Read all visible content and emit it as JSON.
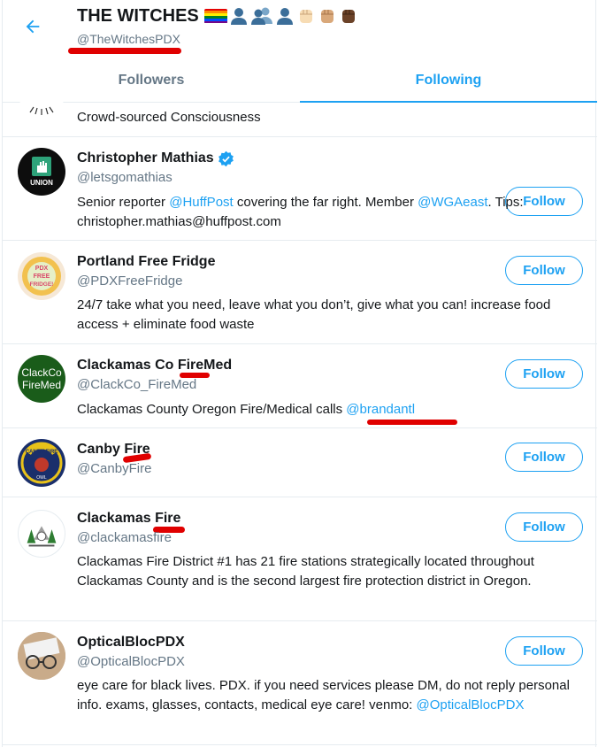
{
  "header": {
    "title": "THE WITCHES",
    "handle": "@TheWitchesPDX"
  },
  "tabs": [
    {
      "label": "Followers",
      "active": false
    },
    {
      "label": "Following",
      "active": true
    }
  ],
  "follow_label": "Follow",
  "accounts": [
    {
      "bio": "Crowd-sourced Consciousness"
    },
    {
      "name": "Christopher Mathias",
      "username": "@letsgomathias",
      "verified": true,
      "avatar_text": "UNION",
      "bio_parts": [
        "Senior reporter ",
        "@HuffPost",
        " covering the far right. Member ",
        "@WGAeast",
        ". Tips: christopher.mathias@huffpost.com"
      ]
    },
    {
      "name": "Portland Free Fridge",
      "username": "@PDXFreeFridge",
      "avatar_text": "PDX FREE FRIDGE!",
      "bio": "24/7 take what you need, leave what you don’t, give what you can! increase food access + eliminate food waste"
    },
    {
      "name": "Clackamas Co FireMed",
      "username": "@ClackCo_FireMed",
      "avatar_text_1": "ClackCo",
      "avatar_text_2": "FireMed",
      "bio_parts": [
        "Clackamas County Oregon Fire/Medical calls ",
        "@brandantl"
      ]
    },
    {
      "name": "Canby Fire",
      "username": "@CanbyFire",
      "avatar_text": "CANBY FIRE"
    },
    {
      "name": "Clackamas Fire",
      "username": "@clackamasfire",
      "bio": "Clackamas Fire District #1 has 21 fire stations strategically located throughout Clackamas County and is the second largest fire protection district in Oregon."
    },
    {
      "name": "OpticalBlocPDX",
      "username": "@OpticalBlocPDX",
      "bio_parts": [
        "eye care for black lives. PDX. if you need services please DM, do not reply personal info. exams, glasses, contacts, medical eye care! venmo: ",
        "@OpticalBlocPDX"
      ]
    }
  ],
  "colors": {
    "accent": "#1da1f2",
    "secondary_text": "#657786",
    "divider": "#e6ecf0",
    "redaction": "#e00000"
  },
  "icons": {
    "back": "back-arrow-icon",
    "verified": "verified-badge-icon"
  }
}
